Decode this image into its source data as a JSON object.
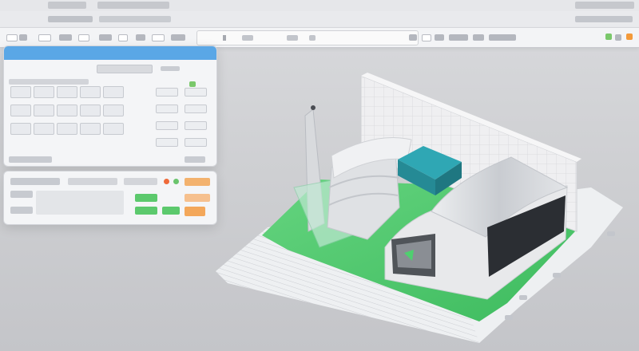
{
  "window": {
    "traffic_lights": {
      "close_color": "#f08a2d",
      "min_color": "#e8602c"
    }
  },
  "toolbar": {
    "address_placeholder": "",
    "icons": [
      "back-icon",
      "forward-icon",
      "reload-icon",
      "home-icon",
      "bookmark-icon",
      "tools-icon",
      "search-icon",
      "settings-icon"
    ]
  },
  "left_panel": {
    "header_color": "#5aa7e6",
    "grid_rows": 3,
    "grid_cols": 6
  },
  "bottom_panel": {
    "accent_green": "#5cc96d",
    "accent_orange": "#f3a75a"
  },
  "scene": {
    "ground_color": "#4fcf6f",
    "roof_color": "#d7d9dd",
    "teal_block": "#2fa7b4"
  }
}
